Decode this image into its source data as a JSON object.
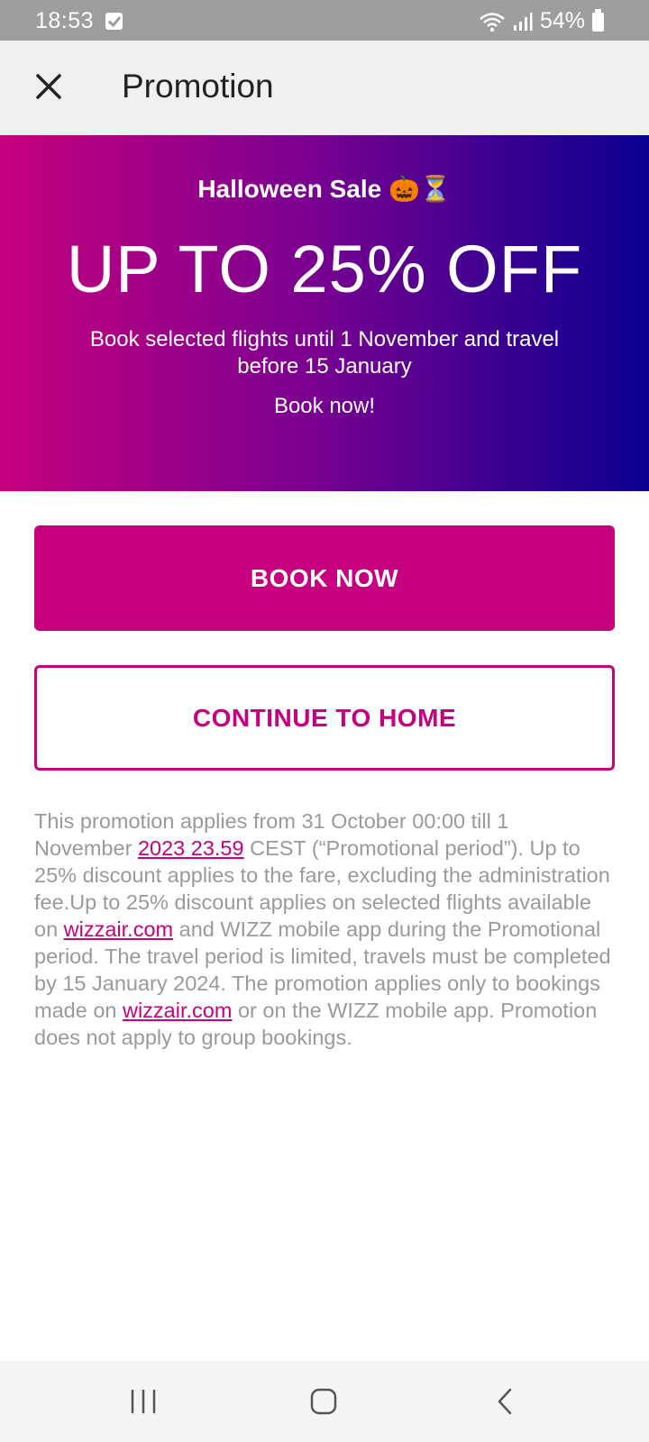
{
  "status_bar": {
    "time": "18:53",
    "battery": "54%"
  },
  "header": {
    "title": "Promotion"
  },
  "banner": {
    "sale": "Halloween Sale 🎃⏳",
    "headline": "UP TO 25% OFF",
    "description": "Book selected flights until 1 November and travel before 15 January",
    "cta": "Book now!"
  },
  "buttons": {
    "book_now": "BOOK NOW",
    "continue_home": "CONTINUE TO HOME"
  },
  "terms": {
    "p1": "This promotion applies from 31 October 00:00 till 1 November ",
    "link1": "2023 23.59",
    "p2": " CEST (“Promotional period”). Up to 25% discount applies to the fare, excluding the administration fee.Up to 25% discount applies on selected flights available on ",
    "link2": "wizzair.com",
    "p3": " and WIZZ mobile app during the Promotional period. The travel period is limited, travels must be completed by 15 January 2024. The promotion applies only to bookings made on ",
    "link3": "wizzair.com",
    "p4": " or on the WIZZ mobile app. Promotion does not apply to group bookings."
  },
  "colors": {
    "brand": "#c6007e",
    "gradient_end": "#0a0090",
    "header_bg": "#f0f0f0",
    "status_bg": "#9e9e9e"
  },
  "icons": [
    "close-icon",
    "wifi-icon",
    "signal-icon",
    "battery-icon",
    "nav-recent-icon",
    "nav-home-icon",
    "nav-back-icon"
  ]
}
